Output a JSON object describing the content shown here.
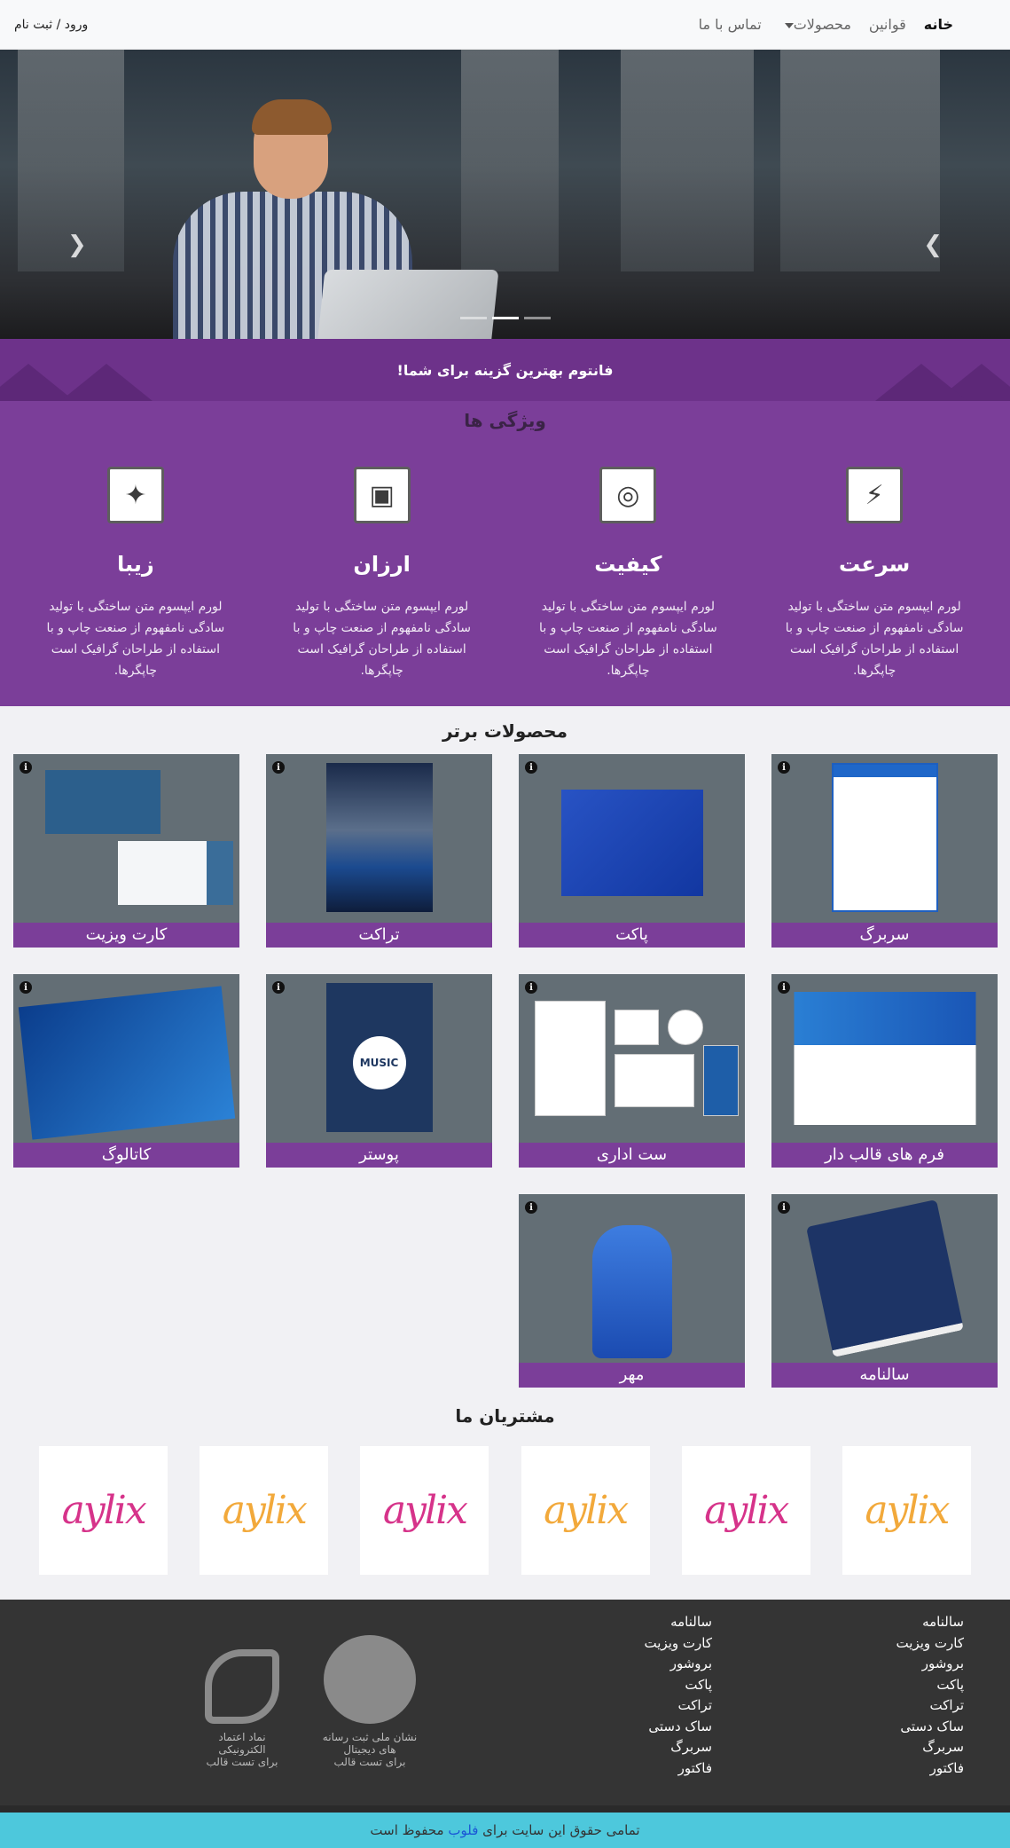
{
  "nav": {
    "home": "خانه",
    "rules": "قوانین",
    "products": "محصولات",
    "contact": "تماس با ما",
    "login": "ورود / ثبت نام"
  },
  "hero": {
    "prev_icon": "chevron-left-icon",
    "next_icon": "chevron-right-icon",
    "slides": 3,
    "active_slide": 2
  },
  "ribbon": {
    "title": "فانتوم بهترین گزینه برای شما!"
  },
  "features": {
    "title": "ویژگی ها",
    "items": [
      {
        "icon": "lightning-icon",
        "title": "سرعت",
        "text": "لورم ایپسوم متن ساختگی با تولید سادگی نامفهوم از صنعت چاپ و با استفاده از طراحان گرافیک است چاپگرها."
      },
      {
        "icon": "lifebuoy-icon",
        "title": "کیفیت",
        "text": "لورم ایپسوم متن ساختگی با تولید سادگی نامفهوم از صنعت چاپ و با استفاده از طراحان گرافیک است چاپگرها."
      },
      {
        "icon": "money-icon",
        "title": "ارزان",
        "text": "لورم ایپسوم متن ساختگی با تولید سادگی نامفهوم از صنعت چاپ و با استفاده از طراحان گرافیک است چاپگرها."
      },
      {
        "icon": "magic-wand-icon",
        "title": "زیبا",
        "text": "لورم ایپسوم متن ساختگی با تولید سادگی نامفهوم از صنعت چاپ و با استفاده از طراحان گرافیک است چاپگرها."
      }
    ]
  },
  "products": {
    "title": "محصولات برتر",
    "items": [
      {
        "label": "سربرگ"
      },
      {
        "label": "پاکت"
      },
      {
        "label": "تراکت"
      },
      {
        "label": "کارت ویزیت"
      },
      {
        "label": "فرم های قالب دار"
      },
      {
        "label": "ست اداری"
      },
      {
        "label": "پوستر"
      },
      {
        "label": "کاتالوگ"
      },
      {
        "label": "سالنامه"
      },
      {
        "label": "مهر"
      }
    ]
  },
  "clients": {
    "title": "مشتریان ما",
    "logo_text": "aylix",
    "colors": [
      "#f2a93b",
      "#d6338a",
      "#f2a93b",
      "#d6338a",
      "#f2a93b",
      "#d6338a"
    ]
  },
  "footer": {
    "col1": [
      "سالنامه",
      "کارت ویزیت",
      "بروشور",
      "پاکت",
      "تراکت",
      "ساک دستی",
      "سربرگ",
      "فاکتور"
    ],
    "col2": [
      "سالنامه",
      "کارت ویزیت",
      "بروشور",
      "پاکت",
      "تراکت",
      "ساک دستی",
      "سربرگ",
      "فاکتور"
    ],
    "badge1": "نشان ملی ثبت رسانه های دیجیتال\nبرای تست قالب",
    "badge2": "نماد اعتماد الکترونیکی\nبرای تست قالب"
  },
  "copyright": {
    "before": "تمامی حقوق این سایت برای",
    "brand": "فلوب",
    "after": "محفوظ است"
  }
}
